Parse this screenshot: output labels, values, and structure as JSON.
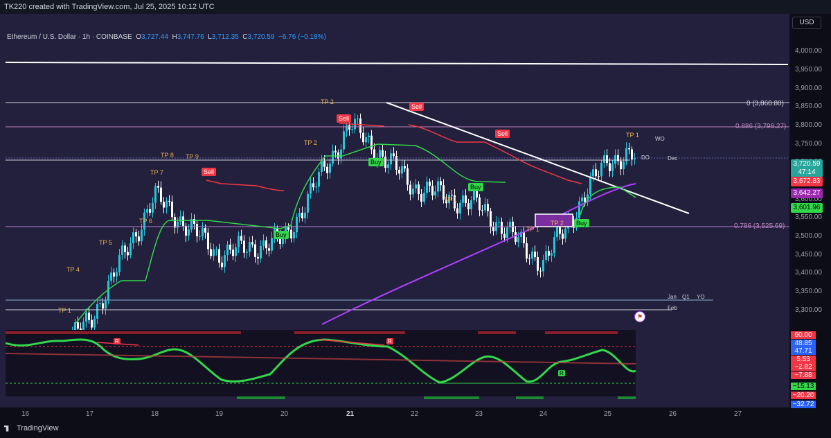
{
  "header": {
    "caption": "TK220 created with TradingView.com, Jul 25, 2025 10:12 UTC"
  },
  "legend": {
    "symbol": "Ethereum / U.S. Dollar · 1h · COINBASE",
    "o_label": "O",
    "o": "3,727.44",
    "h_label": "H",
    "h": "3,747.76",
    "l_label": "L",
    "l": "3,712.35",
    "c_label": "C",
    "c": "3,720.59",
    "change": "−6.76 (−0.18%)"
  },
  "currency": "USD",
  "price_ticks": [
    "4,000.00",
    "3,950.00",
    "3,900.00",
    "3,850.00",
    "3,800.00",
    "3,750.00",
    "3,700.00",
    "3,650.00",
    "3,600.00",
    "3,550.00",
    "3,500.00",
    "3,450.00",
    "3,400.00",
    "3,350.00",
    "3,300.00"
  ],
  "time_ticks": [
    "16",
    "17",
    "18",
    "19",
    "20",
    "21",
    "22",
    "23",
    "24",
    "25",
    "26",
    "27"
  ],
  "price_badges": {
    "last": "3,720.59",
    "countdown": "47:14",
    "red": "3,672.83",
    "purple": "3,642.27",
    "green": "3,601.96"
  },
  "osc_badges": [
    "60.00",
    "48.85",
    "47.71",
    "5.53",
    "−2.82",
    "−7.88",
    "−15.13",
    "−20.20",
    "−32.72"
  ],
  "fib": {
    "level_0": "0 (3,860.80)",
    "level_886": "0.886 (3,798.27)",
    "level_786": "0.786 (3,525.69)"
  },
  "level_tags": {
    "wo": "WO",
    "do": "DO",
    "dec": "Dec",
    "jan": "Jan",
    "q1": "Q1",
    "yo": "YO",
    "feb": "Feb"
  },
  "signals": {
    "tp": [
      "TP 1",
      "TP 2",
      "TP 4",
      "TP 5",
      "TP 6",
      "TP 7",
      "TP 8",
      "TP 9",
      "TP 1",
      "TP 1",
      "TP 2",
      "TP 1",
      "TP 2"
    ],
    "sell": [
      "Sell",
      "Sell",
      "Sell",
      "Sell"
    ],
    "buy": [
      "Buy",
      "Buy",
      "Buy",
      "Buy"
    ],
    "osc_r": [
      "R",
      "R",
      "R"
    ]
  },
  "footer": {
    "brand": "TradingView"
  },
  "colors": {
    "bull": "#26c6da",
    "bear": "#ffffff",
    "supertrend_up": "#32d74b",
    "supertrend_down": "#f23645",
    "ma": "#b040ff",
    "bg": "#22203d",
    "accent": "#2e9fff"
  },
  "chart_data": {
    "type": "line",
    "title": "Ethereum / U.S. Dollar · 1h · COINBASE",
    "x": [
      "16",
      "17",
      "18",
      "19",
      "20",
      "21",
      "22",
      "23",
      "24",
      "25",
      "26",
      "27"
    ],
    "ylim": [
      3270,
      4060
    ],
    "series": [
      {
        "values": [
          3300,
          3420,
          3680,
          3560,
          3590,
          3830,
          3700,
          3660,
          3540,
          3760,
          null,
          null
        ]
      }
    ],
    "levels": {
      "fib_0": 3860.8,
      "fib_0886": 3798.27,
      "fib_0786": 3525.69
    },
    "grid": false,
    "legend": "top-left"
  }
}
